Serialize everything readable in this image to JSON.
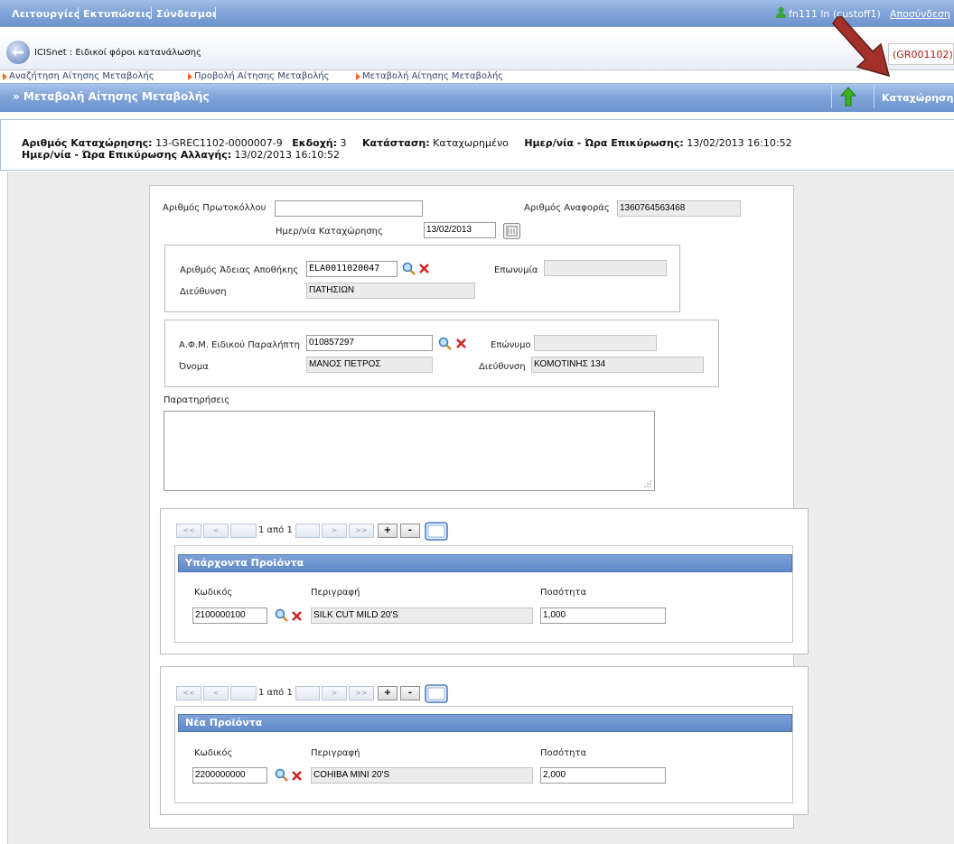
{
  "menu": {
    "items": [
      "Λειτουργίες",
      "Εκτυπώσεις",
      "Σύνδεσμοι"
    ],
    "user": "fn111 ln (custoff1)",
    "logout": "Αποσύνδεση"
  },
  "app": {
    "title": "ICISnet : Ειδικοί φόροι κατανάλωσης",
    "code": "(GR001102)"
  },
  "breadcrumb": [
    "Αναζήτηση Αίτησης Μεταβολής",
    "Προβολή Αίτησης Μεταβολής",
    "Μεταβολή Αίτησης Μεταβολής"
  ],
  "page": {
    "title": "» Μεταβολή Αίτησης Μεταβολής",
    "save_label": "Καταχώρηση"
  },
  "info": {
    "reg_label": "Αριθμός Καταχώρησης:",
    "reg_value": "13-GREC1102-0000007-9",
    "version_label": "Εκδοχή:",
    "version_value": "3",
    "status_label": "Κατάσταση:",
    "status_value": "Καταχωρημένο",
    "validation_label": "Ημερ/νία - Ώρα Επικύρωσης:",
    "validation_value": "13/02/2013 16:10:52",
    "change_label": "Ημερ/νία - Ώρα Επικύρωσης Αλλαγής:",
    "change_value": "13/02/2013 16:10:52"
  },
  "form": {
    "protocol_label": "Αριθμός Πρωτοκόλλου",
    "protocol_value": "",
    "reference_label": "Αριθμός Αναφοράς",
    "reference_value": "1360764563468",
    "regdate_label": "Ημερ/νία Καταχώρησης",
    "regdate_value": "13/02/2013",
    "warehouse": {
      "license_label": "Αριθμός Άδειας Αποθήκης",
      "license_value": "ELA0011020047",
      "name_label": "Επωνυμία",
      "name_value": "",
      "address_label": "Διεύθυνση",
      "address_value": "ΠΑΤΗΣΙΩΝ"
    },
    "receiver": {
      "afm_label": "Α.Φ.Μ. Ειδικού Παραλήπτη",
      "afm_value": "010857297",
      "surname_label": "Επώνυμο",
      "surname_value": "",
      "firstname_label": "Όνομα",
      "firstname_value": "ΜΑΝΟΣ ΠΕΤΡΟΣ",
      "address_label": "Διεύθυνση",
      "address_value": "ΚΟΜΟΤΙΝΗΣ 134"
    },
    "remarks_label": "Παρατηρήσεις",
    "remarks_value": ""
  },
  "pager": {
    "first": "<<",
    "prev": "<",
    "next": ">",
    "last": ">>",
    "page_text": "1 από 1",
    "add": "+",
    "remove": "-"
  },
  "existing_products": {
    "header": "Υπάρχοντα Προϊόντα",
    "code_label": "Κωδικός",
    "desc_label": "Περιγραφή",
    "qty_label": "Ποσότητα",
    "code": "2100000100",
    "desc": "SILK CUT MILD 20'S",
    "qty": "1,000"
  },
  "new_products": {
    "header": "Νέα Προϊόντα",
    "code_label": "Κωδικός",
    "desc_label": "Περιγραφή",
    "qty_label": "Ποσότητα",
    "code": "2200000000",
    "desc": "COHIBA MINI 20'S",
    "qty": "2,000"
  }
}
